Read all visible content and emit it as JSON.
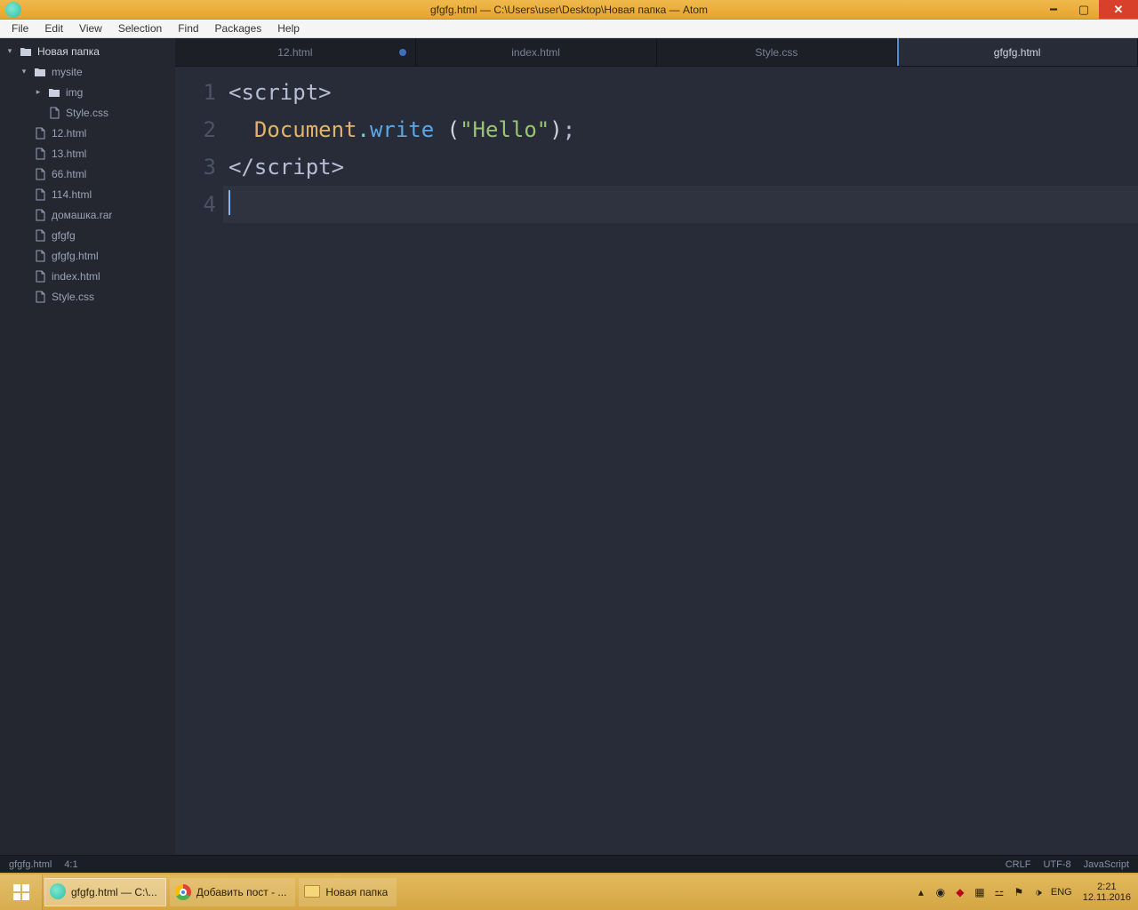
{
  "titlebar": {
    "title": "gfgfg.html — C:\\Users\\user\\Desktop\\Новая папка — Atom"
  },
  "menubar": {
    "items": [
      "File",
      "Edit",
      "View",
      "Selection",
      "Find",
      "Packages",
      "Help"
    ]
  },
  "sidebar": {
    "root": "Новая папка",
    "tree": [
      {
        "type": "folder",
        "label": "mysite",
        "level": 1,
        "expanded": true
      },
      {
        "type": "folder",
        "label": "img",
        "level": 2,
        "expanded": false
      },
      {
        "type": "file",
        "label": "Style.css",
        "level": 2
      },
      {
        "type": "file",
        "label": "12.html",
        "level": 1
      },
      {
        "type": "file",
        "label": "13.html",
        "level": 1
      },
      {
        "type": "file",
        "label": "66.html",
        "level": 1
      },
      {
        "type": "file",
        "label": "114.html",
        "level": 1
      },
      {
        "type": "file",
        "label": "домашка.rar",
        "level": 1
      },
      {
        "type": "file",
        "label": "gfgfg",
        "level": 1
      },
      {
        "type": "file",
        "label": "gfgfg.html",
        "level": 1
      },
      {
        "type": "file",
        "label": "index.html",
        "level": 1
      },
      {
        "type": "file",
        "label": "Style.css",
        "level": 1
      }
    ]
  },
  "tabs": [
    {
      "label": "12.html",
      "modified": true,
      "active": false
    },
    {
      "label": "index.html",
      "modified": false,
      "active": false
    },
    {
      "label": "Style.css",
      "modified": false,
      "active": false
    },
    {
      "label": "gfgfg.html",
      "modified": false,
      "active": true
    }
  ],
  "editor": {
    "gutter": [
      "1",
      "2",
      "3",
      "4"
    ],
    "lines": [
      {
        "tokens": [
          [
            "<script>",
            "c-tag"
          ]
        ]
      },
      {
        "tokens": [
          [
            "  ",
            ""
          ],
          [
            "Document",
            "c-obj"
          ],
          [
            ".",
            "c-punc"
          ],
          [
            "write",
            "c-func"
          ],
          [
            " ",
            ""
          ],
          [
            "(",
            "c-brkt"
          ],
          [
            "\"Hello\"",
            "c-str"
          ],
          [
            ")",
            "c-brkt"
          ],
          [
            ";",
            "c-semi"
          ]
        ]
      },
      {
        "tokens": [
          [
            "</script>",
            "c-tag"
          ]
        ]
      },
      {
        "tokens": [],
        "current": true,
        "cursor": true
      }
    ]
  },
  "statusbar": {
    "filename": "gfgfg.html",
    "cursor_pos": "4:1",
    "line_ending": "CRLF",
    "encoding": "UTF-8",
    "grammar": "JavaScript"
  },
  "taskbar": {
    "items": [
      {
        "icon": "atom",
        "label": "gfgfg.html — C:\\...",
        "active": true
      },
      {
        "icon": "chrome",
        "label": "Добавить пост - ...",
        "active": false
      },
      {
        "icon": "folder",
        "label": "Новая папка",
        "active": false
      }
    ],
    "lang": "ENG",
    "time": "2:21",
    "date": "12.11.2016"
  }
}
